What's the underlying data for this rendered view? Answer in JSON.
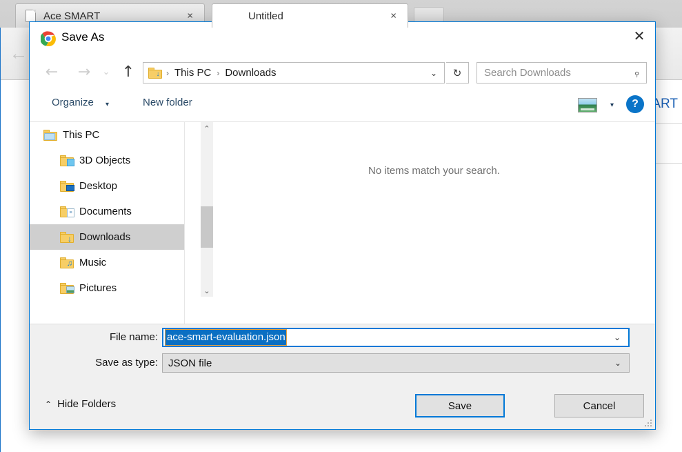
{
  "browser": {
    "tabs": [
      {
        "label": "Ace SMART",
        "active": false,
        "close_label": "×",
        "icon": "page-icon"
      },
      {
        "label": "Untitled",
        "active": true,
        "close_label": "×",
        "icon": "none"
      }
    ],
    "new_tab_label": "",
    "back_icon": "←",
    "page_heading_partial": "ART",
    "app_grid_colors": [
      "#e8453c",
      "#e8453c",
      "#e8453c",
      "#3ba55d",
      "#2b7de9",
      "#f5b400",
      "#3ba55d",
      "#f5b400",
      "#f5b400"
    ]
  },
  "dialog": {
    "title": "Save As",
    "title_icon": "chrome-icon",
    "close_label": "✕",
    "nav": {
      "back_icon": "←",
      "forward_icon": "→",
      "recent_icon": "⌄",
      "up_icon": "↑",
      "refresh_icon": "↻",
      "address_chevron": "⌄",
      "breadcrumb": [
        "This PC",
        "Downloads"
      ],
      "breadcrumb_separator": "›",
      "address_folder_icon": "downloads-folder-icon"
    },
    "search": {
      "placeholder": "Search Downloads",
      "value": "",
      "icon": "⌕"
    },
    "commandbar": {
      "organize_label": "Organize",
      "organize_caret": "▾",
      "new_folder_label": "New folder",
      "view_caret": "▾",
      "help_label": "?"
    },
    "tree": {
      "items": [
        {
          "label": "This PC",
          "icon": "computer-folder-icon",
          "glyph": "🖥",
          "indent": 20,
          "selected": false
        },
        {
          "label": "3D Objects",
          "icon": "3d-objects-folder-icon",
          "glyph": "◧",
          "indent": 44,
          "selected": false
        },
        {
          "label": "Desktop",
          "icon": "desktop-folder-icon",
          "glyph": "▬",
          "indent": 44,
          "selected": false
        },
        {
          "label": "Documents",
          "icon": "documents-folder-icon",
          "glyph": "☰",
          "indent": 44,
          "selected": false
        },
        {
          "label": "Downloads",
          "icon": "downloads-folder-icon",
          "glyph": "↓",
          "indent": 44,
          "selected": true
        },
        {
          "label": "Music",
          "icon": "music-folder-icon",
          "glyph": "♪",
          "indent": 44,
          "selected": false
        },
        {
          "label": "Pictures",
          "icon": "pictures-folder-icon",
          "glyph": "▤",
          "indent": 44,
          "selected": false
        }
      ],
      "scroll_up_icon": "⌃",
      "scroll_down_icon": "⌄"
    },
    "filelist": {
      "empty_message": "No items match your search."
    },
    "fields": {
      "file_name_label": "File name:",
      "file_name_value": "ace-smart-evaluation.json",
      "file_name_caret": "⌄",
      "save_as_type_label": "Save as type:",
      "save_as_type_value": "JSON file",
      "save_as_type_caret": "⌄"
    },
    "footer": {
      "hide_folders_label": "Hide Folders",
      "hide_folders_caret": "⌃",
      "save_label": "Save",
      "cancel_label": "Cancel"
    },
    "colors": {
      "accent": "#0078d7",
      "selection": "#0a6fc2",
      "dialog_bg": "#f0f0f0"
    }
  }
}
